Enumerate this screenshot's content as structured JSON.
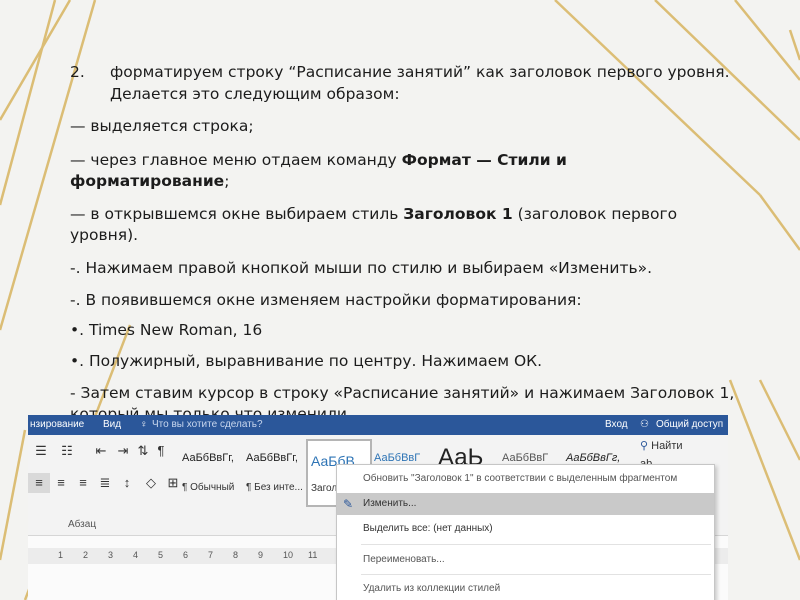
{
  "slide": {
    "item_number": "2.",
    "item_line1": "форматируем строку “Расписание занятий” как заголовок первого уровня.",
    "item_line2": "Делается это следующим образом:",
    "step1": "— выделяется строка;",
    "step2_prefix": "— через главное меню отдаем команду ",
    "step2_bold1": "Формат — Стили и",
    "step2_bold2": "форматирование",
    "step2_suffix": ";",
    "step3_prefix": "— в открывшемся окне выбираем стиль ",
    "step3_bold": "Заголовок 1",
    "step3_suffix": " (заголовок первого",
    "step3_line2": "уровня).",
    "step4": "-.  Нажимаем правой кнопкой мыши по стилю и выбираем «Изменить».",
    "step5": "-.  В появившемся окне изменяем настройки форматирования:",
    "step6": "•.  Times New Roman, 16",
    "step7": "•.  Полужирный, выравнивание по центру. Нажимаем ОК.",
    "step8": "- Затем ставим курсор в строку «Расписание занятий» и нажимаем Заголовок 1,",
    "step8_line2": "который мы только что изменили."
  },
  "word": {
    "tabs": {
      "review": "нзирование",
      "view": "Вид",
      "help_search": "Что вы хотите сделать?",
      "signin": "Вход",
      "share": "Общий доступ"
    },
    "paragraph_group_label": "Абзац",
    "styles": [
      {
        "preview": "АаБбВвГг,",
        "name": "¶ Обычный"
      },
      {
        "preview": "АаБбВвГг,",
        "name": "¶ Без инте..."
      },
      {
        "preview": "АаБбВ",
        "name": "Загол"
      },
      {
        "preview": "АаБбВвГ",
        "name": ""
      },
      {
        "preview": "АаЬ",
        "name": ""
      },
      {
        "preview": "АаБбВвГ",
        "name": ""
      },
      {
        "preview": "АаБбВвГг,",
        "name": ""
      }
    ],
    "find_label": "Найти",
    "replace_hint": "ab",
    "ruler_marks": [
      "1",
      "2",
      "3",
      "4",
      "5",
      "6",
      "7",
      "8",
      "9",
      "10",
      "11"
    ],
    "context_menu": [
      {
        "label": "Обновить \"Заголовок 1\" в соответствии с выделенным фрагментом",
        "icon": ""
      },
      {
        "label": "Изменить...",
        "icon": "edit-style-icon",
        "highlighted": true
      },
      {
        "label": "Выделить все: (нет данных)",
        "icon": ""
      },
      {
        "label": "Переименовать...",
        "icon": ""
      },
      {
        "label": "Удалить из коллекции стилей",
        "icon": ""
      }
    ]
  }
}
